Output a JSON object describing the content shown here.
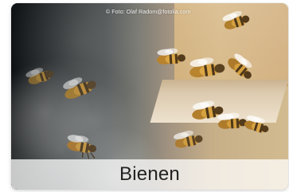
{
  "tile": {
    "credit": "© Foto: Olaf Radom@fotolia.com",
    "title": "Bienen"
  },
  "icons": {
    "bee": "bee-icon"
  },
  "colors": {
    "overlay": "#ffffff",
    "title": "#222222",
    "credit": "#ffffff"
  }
}
